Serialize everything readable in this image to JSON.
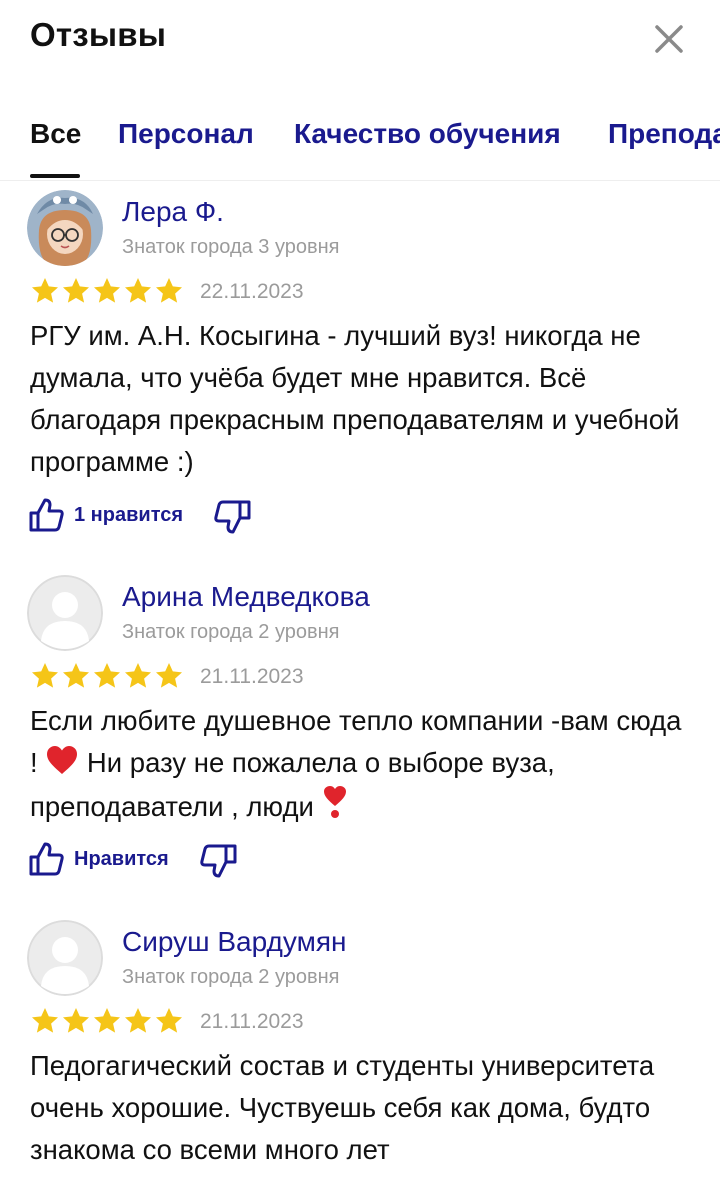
{
  "header": {
    "title": "Отзывы"
  },
  "tabs": [
    {
      "label": "Все",
      "active": true
    },
    {
      "label": "Персонал"
    },
    {
      "label": "Качество обучения"
    },
    {
      "label": "Преподаватели"
    }
  ],
  "reviews": [
    {
      "author": "Лера Ф.",
      "level": "Знаток города 3 уровня",
      "rating": 5,
      "date": "22.11.2023",
      "text": "РГУ им. А.Н. Косыгина - лучший вуз! никогда не думала, что учёба будет мне нравится. Всё благодаря прекрасным преподавателям и учебной программе :)",
      "like_label": "1 нравится"
    },
    {
      "author": "Арина Медведкова",
      "level": "Знаток города 2 уровня",
      "rating": 5,
      "date": "21.11.2023",
      "text_part1": "Если любите душевное тепло компании -вам сюда !",
      "text_part2": "Ни разу не пожалела о выборе вуза, преподаватели , люди",
      "like_label": "Нравится"
    },
    {
      "author": "Сируш Вардумян",
      "level": "Знаток города 2 уровня",
      "rating": 5,
      "date": "21.11.2023",
      "text": "Педогагический состав и студенты университета очень хорошие. Чуствуешь себя как дома, будто знакома со всеми много лет"
    }
  ],
  "colors": {
    "link": "#1a1a8e",
    "star": "#f5c518",
    "muted": "#9b9b9b",
    "heart": "#e0242c"
  }
}
